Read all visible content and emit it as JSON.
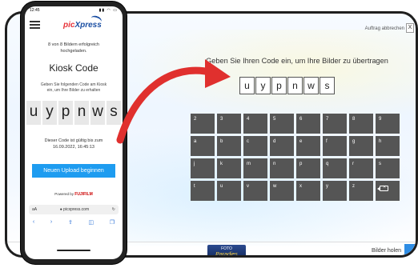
{
  "kiosk": {
    "cancel_label": "Auftrag abbrechen",
    "cancel_x": "X",
    "title": "Geben Sie Ihren Code ein, um Ihre Bilder zu übertragen",
    "code": [
      "u",
      "y",
      "p",
      "n",
      "w",
      "s"
    ],
    "keyboard": [
      [
        "2",
        "3",
        "4",
        "5",
        "6",
        "7",
        "8",
        "9"
      ],
      [
        "a",
        "b",
        "c",
        "d",
        "e",
        "f",
        "g",
        "h"
      ],
      [
        "j",
        "k",
        "m",
        "n",
        "p",
        "q",
        "r",
        "s"
      ],
      [
        "t",
        "u",
        "v",
        "w",
        "x",
        "y",
        "z",
        "⌫"
      ]
    ],
    "brand_top": "FOTO",
    "brand_name": "Paradies",
    "fetch_label": "Bilder holen"
  },
  "phone": {
    "time": "12:45",
    "status_icons": "▮▮ ◠ ▭",
    "logo_pic": "pic",
    "logo_x": "Xpress",
    "upload_msg_1": "8 von 8 Bildern erfolgreich",
    "upload_msg_2": "hochgeladen.",
    "title": "Kiosk Code",
    "instr_1": "Geben Sie folgenden Code am Kiosk",
    "instr_2": "ein, um Ihre Bilder zu erhalten",
    "code": [
      "u",
      "y",
      "p",
      "n",
      "w",
      "s"
    ],
    "valid_1": "Dieser Code ist gültig bis zum",
    "valid_2": "16.09.2022, 16:45:13",
    "new_upload_label": "Neuen Upload beginnen",
    "powered_prefix": "Powered by",
    "powered_brand": "FUJIFILM",
    "url_aa": "aA",
    "url": "● picxpress.com",
    "reload": "↻",
    "nav": [
      "‹",
      "›",
      "⇪",
      "◫",
      "❐"
    ]
  },
  "colors": {
    "key_bg": "#555555",
    "arrow": "#e0302e",
    "phone_button": "#1e9cf0"
  }
}
